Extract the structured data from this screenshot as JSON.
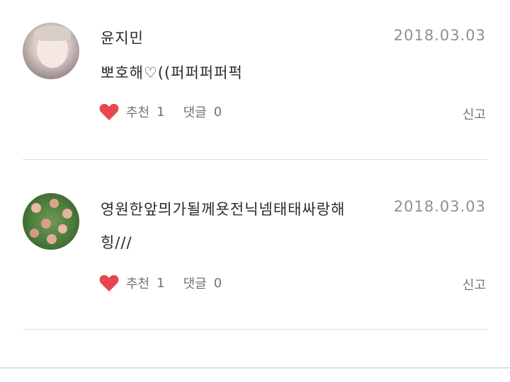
{
  "comments": [
    {
      "author": "윤지민",
      "date": "2018.03.03",
      "text": "뽀호해♡((퍼퍼퍼퍼퍽",
      "like_label": "추천",
      "like_count": "1",
      "reply_label": "댓글",
      "reply_count": "0",
      "report_label": "신고"
    },
    {
      "author": "영원한앞믜가될께욧전닉넴태태싸랑해",
      "date": "2018.03.03",
      "text": "힝///",
      "like_label": "추천",
      "like_count": "1",
      "reply_label": "댓글",
      "reply_count": "0",
      "report_label": "신고"
    }
  ],
  "colors": {
    "heart": "#e8464f",
    "divider": "#d9e3e3",
    "date": "#8b9197",
    "muted": "#6e7378"
  },
  "icons": [
    "heart-icon"
  ]
}
